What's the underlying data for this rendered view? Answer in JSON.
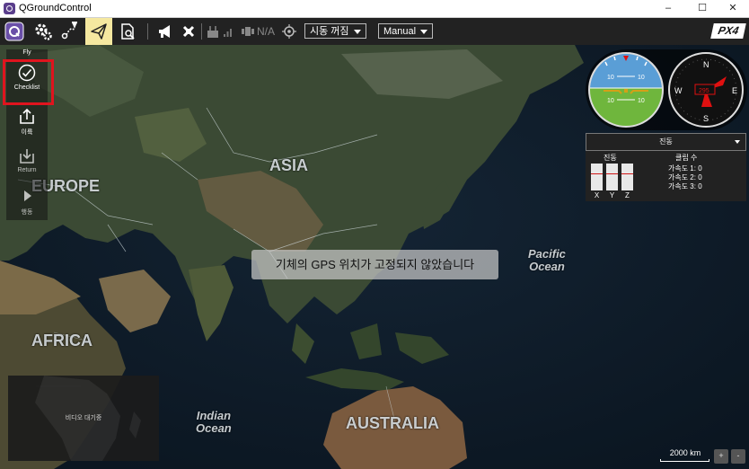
{
  "window": {
    "title": "QGroundControl",
    "minimize": "–",
    "maximize": "☐",
    "close": "✕"
  },
  "toolbar": {
    "gps_status": "N/A",
    "flight_mode": "시동 꺼짐",
    "manual_mode": "Manual",
    "brand": "PX4"
  },
  "left_panel": {
    "header": "Fly",
    "items": [
      {
        "label": "Checklist",
        "icon": "checklist-icon"
      },
      {
        "label": "이륙",
        "icon": "takeoff-icon"
      },
      {
        "label": "Return",
        "icon": "return-icon"
      },
      {
        "label": "행동",
        "icon": "play-icon"
      }
    ]
  },
  "map_labels": {
    "asia": "ASIA",
    "europe": "EUROPE",
    "africa": "AFRICA",
    "australia": "AUSTRALIA",
    "pacific": "Pacific\nOcean",
    "indian": "Indian\nOcean"
  },
  "gps_message": "기체의 GPS 위치가 고정되지 않았습니다",
  "attitude": {
    "pitch_marks": [
      "10",
      "10",
      "10",
      "10"
    ]
  },
  "compass": {
    "n": "N",
    "e": "E",
    "s": "S",
    "w": "W",
    "heading": "295"
  },
  "vibration_panel": {
    "dropdown_label": "진동",
    "vibration_title": "진동",
    "axes": [
      "X",
      "Y",
      "Z"
    ],
    "clipping_title": "클립 수",
    "clip_rows": [
      "가속도 1: 0",
      "가속도 2: 0",
      "가속도 3: 0"
    ]
  },
  "video": {
    "placeholder": "비디오 대기중"
  },
  "scale": {
    "label": "2000 km"
  },
  "zoom": {
    "in": "+",
    "out": "-"
  }
}
